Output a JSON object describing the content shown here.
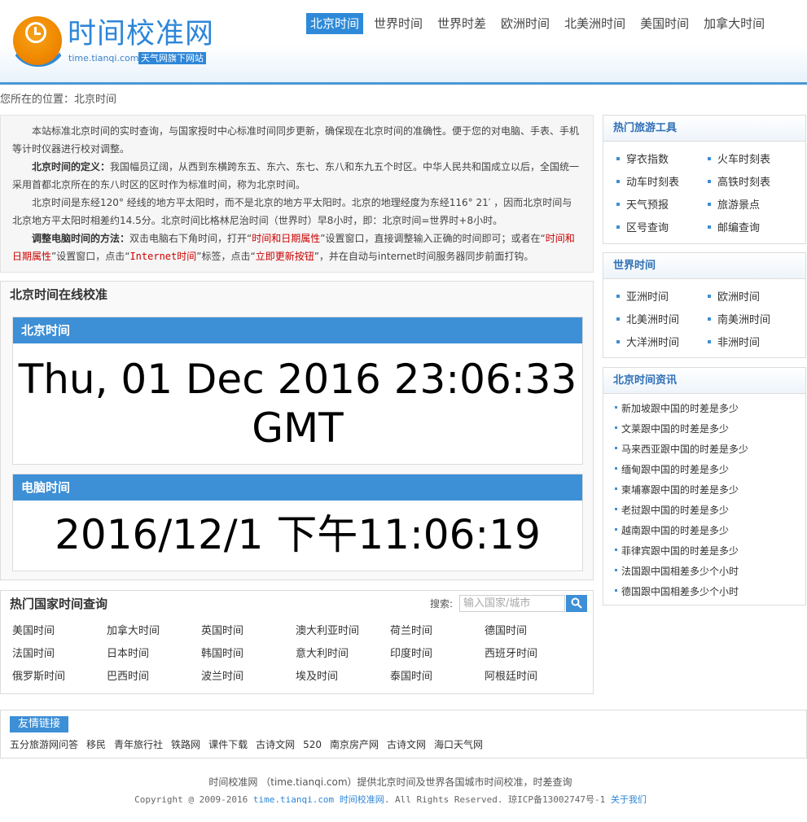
{
  "header": {
    "logo_title": "时间校准网",
    "logo_domain": "time.tianqi.com",
    "logo_badge": "天气网旗下网站",
    "nav": [
      "北京时间",
      "世界时间",
      "世界时差",
      "欧洲时间",
      "北美洲时间",
      "美国时间",
      "加拿大时间"
    ],
    "active_nav_index": 0
  },
  "breadcrumb": "您所在的位置：北京时间",
  "intro": {
    "p1": "本站标准北京时间的实时查询，与国家授时中心标准时间同步更新，确保现在北京时间的准确性。便于您的对电脑、手表、手机等计时仪器进行校对调整。",
    "p2_bold": "北京时间的定义：",
    "p2": "我国幅员辽阔，从西到东横跨东五、东六、东七、东八和东九五个时区。中华人民共和国成立以后，全国统一采用首都北京所在的东八时区的区时作为标准时间，称为北京时间。",
    "p3": "北京时间是东经120° 经线的地方平太阳时，而不是北京的地方平太阳时。北京的地理经度为东经116° 21′ ，因而北京时间与北京地方平太阳时相差约14.5分。北京时间比格林尼治时间（世界时）早8小时，即：北京时间=世界时+8小时。",
    "p4_bold": "调整电脑时间的方法：",
    "p4_a": "双击电脑右下角时间，打开“",
    "p4_red1": "时间和日期属性",
    "p4_b": "”设置窗口，直接调整输入正确的时间即可；或者在“",
    "p4_red2": "时间和日期属性",
    "p4_c": "”设置窗口，点击“",
    "p4_red3": "Internet时间",
    "p4_d": "”标签，点击“",
    "p4_red4": "立即更新按钮",
    "p4_e": "”，并在自动与internet时间服务器同步前面打钩。"
  },
  "calibration": {
    "title": "北京时间在线校准",
    "beijing_label": "北京时间",
    "beijing_value": "Thu, 01 Dec 2016 23:06:33 GMT",
    "pc_label": "电脑时间",
    "pc_value": "2016/12/1 下午11:06:19"
  },
  "hot_countries": {
    "title": "热门国家时间查询",
    "search_label": "搜索:",
    "search_placeholder": "输入国家/城市",
    "items": [
      "美国时间",
      "加拿大时间",
      "英国时间",
      "澳大利亚时间",
      "荷兰时间",
      "德国时间",
      "法国时间",
      "日本时间",
      "韩国时间",
      "意大利时间",
      "印度时间",
      "西班牙时间",
      "俄罗斯时间",
      "巴西时间",
      "波兰时间",
      "埃及时间",
      "泰国时间",
      "阿根廷时间"
    ]
  },
  "sidebar": {
    "travel": {
      "title": "热门旅游工具",
      "items": [
        "穿衣指数",
        "火车时刻表",
        "动车时刻表",
        "高铁时刻表",
        "天气预报",
        "旅游景点",
        "区号查询",
        "邮编查询"
      ]
    },
    "world": {
      "title": "世界时间",
      "items": [
        "亚洲时间",
        "欧洲时间",
        "北美洲时间",
        "南美洲时间",
        "大洋洲时间",
        "非洲时间"
      ]
    },
    "news": {
      "title": "北京时间资讯",
      "items": [
        "新加坡跟中国的时差是多少",
        "文莱跟中国的时差是多少",
        "马来西亚跟中国的时差是多少",
        "缅甸跟中国的时差是多少",
        "柬埔寨跟中国的时差是多少",
        "老挝跟中国的时差是多少",
        "越南跟中国的时差是多少",
        "菲律宾跟中国的时差是多少",
        "法国跟中国相差多少个小时",
        "德国跟中国相差多少个小时"
      ]
    }
  },
  "friend_links": {
    "title": "友情链接",
    "items": [
      "五分旅游网问答",
      "移民",
      "青年旅行社",
      "铁路网",
      "课件下载",
      "古诗文网",
      "520",
      "南京房产网",
      "古诗文网",
      "海口天气网"
    ]
  },
  "footer": {
    "line1": "时间校准网 （time.tianqi.com）提供北京时间及世界各国城市时间校准，时差查询",
    "copyright": "Copyright @ 2009-2016",
    "domain_link": "time.tianqi.com",
    "site_link": "时间校准网",
    "rights": ". All Rights Reserved. 琼ICP备13002747号-1",
    "about_link": "关于我们"
  }
}
